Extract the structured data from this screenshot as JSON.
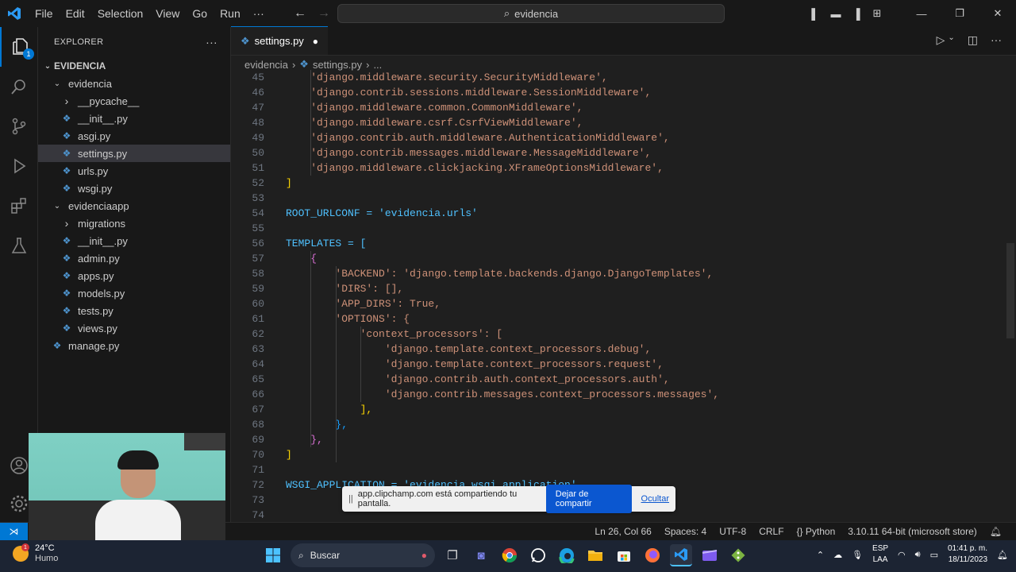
{
  "titlebar": {
    "menu": [
      "File",
      "Edit",
      "Selection",
      "View",
      "Go",
      "Run",
      "···"
    ],
    "search": "evidencia",
    "colors": {
      "accent": "#0078d4",
      "bg": "#181818"
    }
  },
  "activity": {
    "explorer_badge": "1"
  },
  "sidebar": {
    "title": "EXPLORER",
    "more": "···",
    "root": "EVIDENCIA",
    "items": [
      {
        "label": "evidencia",
        "kind": "folder-open",
        "depth": 1
      },
      {
        "label": "__pycache__",
        "kind": "folder-closed",
        "depth": 2
      },
      {
        "label": "__init__.py",
        "kind": "py",
        "depth": 2
      },
      {
        "label": "asgi.py",
        "kind": "py",
        "depth": 2
      },
      {
        "label": "settings.py",
        "kind": "py",
        "depth": 2,
        "selected": true
      },
      {
        "label": "urls.py",
        "kind": "py",
        "depth": 2
      },
      {
        "label": "wsgi.py",
        "kind": "py",
        "depth": 2
      },
      {
        "label": "evidenciaapp",
        "kind": "folder-open",
        "depth": 1
      },
      {
        "label": "migrations",
        "kind": "folder-closed",
        "depth": 2
      },
      {
        "label": "__init__.py",
        "kind": "py",
        "depth": 2
      },
      {
        "label": "admin.py",
        "kind": "py",
        "depth": 2
      },
      {
        "label": "apps.py",
        "kind": "py",
        "depth": 2
      },
      {
        "label": "models.py",
        "kind": "py",
        "depth": 2
      },
      {
        "label": "tests.py",
        "kind": "py",
        "depth": 2
      },
      {
        "label": "views.py",
        "kind": "py",
        "depth": 2
      },
      {
        "label": "manage.py",
        "kind": "py",
        "depth": 1
      }
    ]
  },
  "editor": {
    "tab": {
      "label": "settings.py",
      "dirty": "●"
    },
    "breadcrumb": {
      "folder": "evidencia",
      "file": "settings.py",
      "more": "..."
    },
    "lines": [
      {
        "n": "45",
        "text": "    'django.middleware.security.SecurityMiddleware',",
        "cls": "s"
      },
      {
        "n": "46",
        "text": "    'django.contrib.sessions.middleware.SessionMiddleware',",
        "cls": "s"
      },
      {
        "n": "47",
        "text": "    'django.middleware.common.CommonMiddleware',",
        "cls": "s"
      },
      {
        "n": "48",
        "text": "    'django.middleware.csrf.CsrfViewMiddleware',",
        "cls": "s"
      },
      {
        "n": "49",
        "text": "    'django.contrib.auth.middleware.AuthenticationMiddleware',",
        "cls": "s"
      },
      {
        "n": "50",
        "text": "    'django.contrib.messages.middleware.MessageMiddleware',",
        "cls": "s"
      },
      {
        "n": "51",
        "text": "    'django.middleware.clickjacking.XFrameOptionsMiddleware',",
        "cls": "s"
      },
      {
        "n": "52",
        "text": "]",
        "cls": "b1"
      },
      {
        "n": "53",
        "text": "",
        "cls": "o"
      },
      {
        "n": "54",
        "text": "ROOT_URLCONF = 'evidencia.urls'",
        "cls": "v"
      },
      {
        "n": "55",
        "text": "",
        "cls": "o"
      },
      {
        "n": "56",
        "text": "TEMPLATES = [",
        "cls": "v"
      },
      {
        "n": "57",
        "text": "    {",
        "cls": "b2"
      },
      {
        "n": "58",
        "text": "        'BACKEND': 'django.template.backends.django.DjangoTemplates',",
        "cls": "s"
      },
      {
        "n": "59",
        "text": "        'DIRS': [],",
        "cls": "s"
      },
      {
        "n": "60",
        "text": "        'APP_DIRS': True,",
        "cls": "s"
      },
      {
        "n": "61",
        "text": "        'OPTIONS': {",
        "cls": "s"
      },
      {
        "n": "62",
        "text": "            'context_processors': [",
        "cls": "s"
      },
      {
        "n": "63",
        "text": "                'django.template.context_processors.debug',",
        "cls": "s"
      },
      {
        "n": "64",
        "text": "                'django.template.context_processors.request',",
        "cls": "s"
      },
      {
        "n": "65",
        "text": "                'django.contrib.auth.context_processors.auth',",
        "cls": "s"
      },
      {
        "n": "66",
        "text": "                'django.contrib.messages.context_processors.messages',",
        "cls": "s"
      },
      {
        "n": "67",
        "text": "            ],",
        "cls": "b1"
      },
      {
        "n": "68",
        "text": "        },",
        "cls": "b3"
      },
      {
        "n": "69",
        "text": "    },",
        "cls": "b2"
      },
      {
        "n": "70",
        "text": "]",
        "cls": "b1"
      },
      {
        "n": "71",
        "text": "",
        "cls": "o"
      },
      {
        "n": "72",
        "text": "WSGI_APPLICATION = 'evidencia.wsgi.application'",
        "cls": "v"
      },
      {
        "n": "73",
        "text": "",
        "cls": "o"
      },
      {
        "n": "74",
        "text": "",
        "cls": "o"
      }
    ]
  },
  "share_bar": {
    "message": "app.clipchamp.com está compartiendo tu pantalla.",
    "stop": "Dejar de compartir",
    "hide": "Ocultar"
  },
  "status": {
    "position": "Ln 26, Col 66",
    "spaces": "Spaces: 4",
    "encoding": "UTF-8",
    "eol": "CRLF",
    "language": "Python",
    "interpreter": "3.10.11 64-bit (microsoft store)"
  },
  "taskbar": {
    "weather_temp": "24°C",
    "weather_desc": "Humo",
    "weather_badge": "1",
    "search": "Buscar",
    "lang1": "ESP",
    "lang2": "LAA",
    "time": "01:41 p. m.",
    "date": "18/11/2023"
  }
}
